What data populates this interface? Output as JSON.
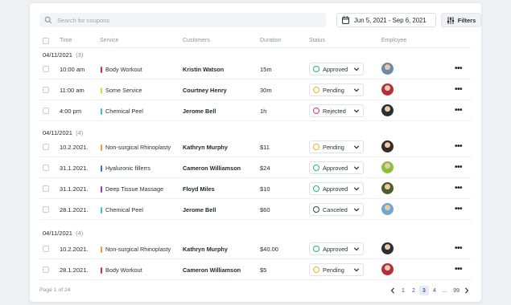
{
  "search": {
    "placeholder": "Search for coupons"
  },
  "date_range": "Jun 5, 2021 - Sep 6, 2021",
  "filters_label": "Filters",
  "columns": [
    "Time",
    "Service",
    "Customers",
    "Duration",
    "Status",
    "Employee"
  ],
  "groups": [
    {
      "date": "04/11/2021",
      "count": "(3)"
    },
    {
      "date": "04/11/2021",
      "count": "(4)"
    },
    {
      "date": "04/11/2021",
      "count": "(4)"
    }
  ],
  "rows": [
    {
      "time": "10:00 am",
      "service": "Body Workout",
      "service_color": "#d7263d",
      "customer": "Kristin Watson",
      "duration": "15m",
      "status": "Approved",
      "status_color": "#27b36b",
      "avatar_color": "#6a8aa6"
    },
    {
      "time": "11:00 am",
      "service": "Some Service",
      "service_color": "#e4d63a",
      "customer": "Courtney Henry",
      "duration": "30m",
      "status": "Pending",
      "status_color": "#f0b429",
      "avatar_color": "#b0303b"
    },
    {
      "time": "4:00 pm",
      "service": "Chemical Peel",
      "service_color": "#2cc7c2",
      "customer": "Jerome Bell",
      "duration": "1h",
      "status": "Rejected",
      "status_color": "#d8307e",
      "avatar_color": "#2a2f36"
    },
    {
      "time": "10.2.2021.",
      "service": "Non-surgical Rhinoplasty",
      "service_color": "#f0a020",
      "customer": "Kathryn Murphy",
      "duration": "$11",
      "status": "Pending",
      "status_color": "#f0b429",
      "avatar_color": "#3a2a26"
    },
    {
      "time": "31.1.2021.",
      "service": "Hyaluronic fillerrs",
      "service_color": "#3d6be0",
      "customer": "Cameron Williamson",
      "duration": "$24",
      "status": "Approved",
      "status_color": "#27b36b",
      "avatar_color": "#8bbf3a"
    },
    {
      "time": "31.1.2021.",
      "service": "Deep Tissue Massage",
      "service_color": "#8a3fd1",
      "customer": "Floyd Miles",
      "duration": "$10",
      "status": "Approved",
      "status_color": "#27b36b",
      "avatar_color": "#4d5e2a"
    },
    {
      "time": "28.1.2021.",
      "service": "Chemical Peel",
      "service_color": "#2cc7c2",
      "customer": "Jerome Bell",
      "duration": "$60",
      "status": "Canceled",
      "status_color": "#3c4250",
      "avatar_color": "#6fa7d1"
    },
    {
      "time": "10.2.2021.",
      "service": "Non-surgical Rhinoplasty",
      "service_color": "#f0a020",
      "customer": "Kathryn Murphy",
      "duration": "$40.00",
      "status": "Approved",
      "status_color": "#27b36b",
      "avatar_color": "#2a2f36"
    },
    {
      "time": "28.1.2021.",
      "service": "Body Workout",
      "service_color": "#d7263d",
      "customer": "Cameron Williamson",
      "duration": "$5",
      "status": "Pending",
      "status_color": "#f0b429",
      "avatar_color": "#b0303b"
    }
  ],
  "footer": {
    "page_info": "Page 1 of 24",
    "pages": [
      "1",
      "2",
      "3",
      "4",
      "...",
      "99"
    ],
    "current_page": "3"
  }
}
